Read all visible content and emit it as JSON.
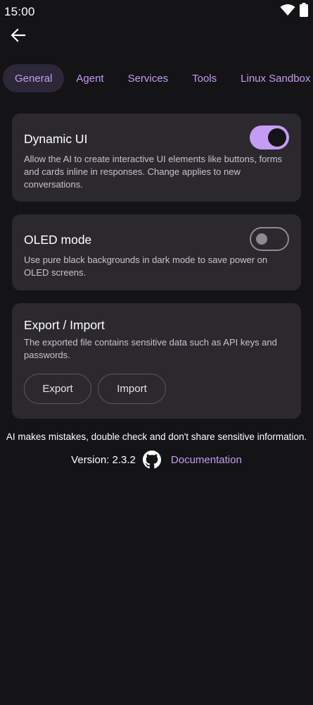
{
  "status_bar": {
    "time": "15:00",
    "icons": [
      "wifi-icon",
      "battery-icon"
    ]
  },
  "header": {
    "back_icon": "arrow-left-icon"
  },
  "tabs": [
    {
      "label": "General",
      "active": true
    },
    {
      "label": "Agent",
      "active": false
    },
    {
      "label": "Services",
      "active": false
    },
    {
      "label": "Tools",
      "active": false
    },
    {
      "label": "Linux Sandbox",
      "active": false
    }
  ],
  "cards": {
    "dynamic_ui": {
      "title": "Dynamic UI",
      "description": "Allow the AI to create interactive UI elements like buttons, forms and cards inline in responses. Change applies to new conversations.",
      "enabled": true
    },
    "oled_mode": {
      "title": "OLED mode",
      "description": "Use pure black backgrounds in dark mode to save power on OLED screens.",
      "enabled": false
    },
    "export_import": {
      "title": "Export / Import",
      "description": "The exported file contains sensitive data such as API keys and passwords.",
      "export_label": "Export",
      "import_label": "Import"
    }
  },
  "footer": {
    "disclaimer": "AI makes mistakes, double check and don't share sensitive information.",
    "version": "Version: 2.3.2",
    "github_icon": "github-icon",
    "documentation_label": "Documentation"
  },
  "colors": {
    "background": "#141316",
    "card": "#2b292e",
    "accent": "#c59cf5",
    "active_tab": "#2c2838"
  }
}
